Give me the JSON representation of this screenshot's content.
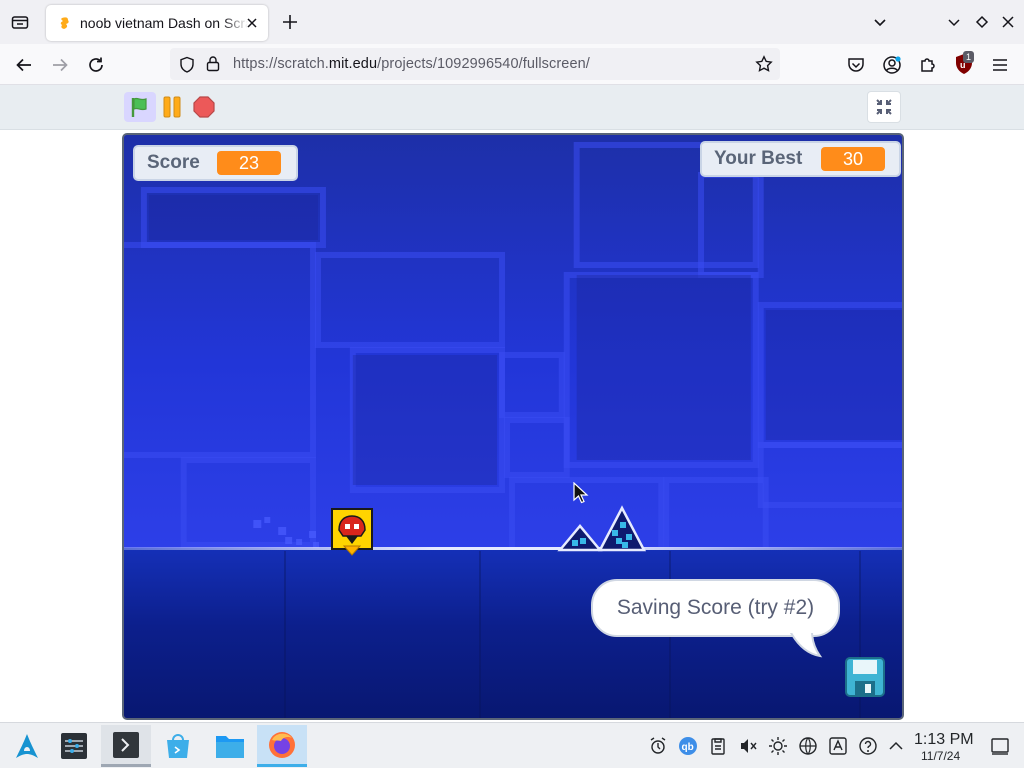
{
  "browser": {
    "tab_title": "noob vietnam Dash on Scratch",
    "url_prefix": "https://scratch.",
    "url_host": "mit.edu",
    "url_path": "/projects/1092996540/fullscreen/",
    "extension_badge": "1"
  },
  "player": {
    "score_label": "Score",
    "score_value": "23",
    "best_label": "Your Best",
    "best_value": "30",
    "speech_bubble": "Saving Score (try #2)"
  },
  "taskbar": {
    "time": "1:13 PM",
    "date": "11/7/24"
  },
  "colors": {
    "accent_orange": "#ff8c1a",
    "stage_blue": "#2236d8",
    "flag_green": "#4cbf56",
    "stop_red": "#ec5959"
  }
}
